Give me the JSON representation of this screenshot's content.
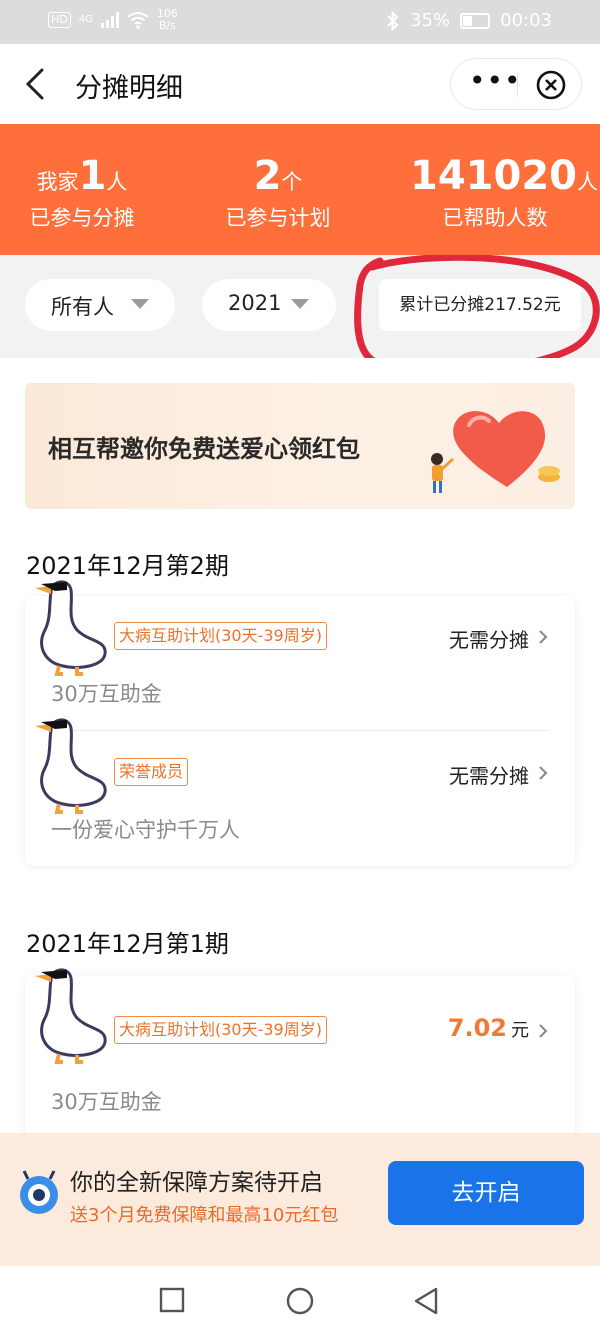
{
  "status_bar": {
    "hd": "HD",
    "signal": "4G",
    "net_speed": "106",
    "net_unit": "B/s",
    "battery": "35%",
    "battery_level": 0.35,
    "time": "00:03"
  },
  "nav": {
    "title": "分摊明细",
    "more": "•••"
  },
  "stats": [
    {
      "prefix": "我家",
      "number": "1",
      "unit": "人",
      "label": "已参与分摊"
    },
    {
      "prefix": "",
      "number": "2",
      "unit": "个",
      "label": "已参与计划"
    },
    {
      "prefix": "",
      "number": "141020",
      "unit": "人",
      "label": "已帮助人数"
    }
  ],
  "filters": {
    "person": "所有人",
    "year": "2021",
    "total": "累计已分摊217.52元"
  },
  "banner": {
    "text": "相互帮邀你免费送爱心领红包"
  },
  "periods": [
    {
      "title": "2021年12月第2期",
      "items": [
        {
          "tag": "大病互助计划(30天-39周岁)",
          "subtitle": "30万互助金",
          "status": "无需分摊"
        },
        {
          "tag": "荣誉成员",
          "subtitle": "一份爱心守护千万人",
          "status": "无需分摊"
        }
      ]
    },
    {
      "title": "2021年12月第1期",
      "items": [
        {
          "tag": "大病互助计划(30天-39周岁)",
          "subtitle": "30万互助金",
          "amount": "7.02",
          "amount_unit": "元"
        }
      ]
    }
  ],
  "promo": {
    "title": "你的全新保障方案待开启",
    "subtitle": "送3个月免费保障和最高10元红包",
    "button": "去开启"
  },
  "colors": {
    "brand_orange": "#ff6f3c",
    "button_blue": "#1a73e8",
    "annotation_red": "#e0283c"
  }
}
